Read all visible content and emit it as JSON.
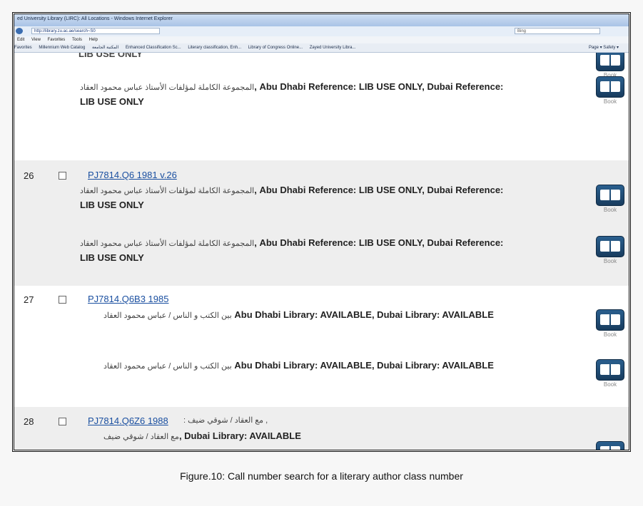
{
  "browser": {
    "title": "ed University Library (LIRC): All Locations - Windows Internet Explorer",
    "url": "http://library.zu.ac.ae/search~S0",
    "search_box": "Bing",
    "menu": [
      "Edit",
      "View",
      "Favorites",
      "Tools",
      "Help"
    ],
    "favorites": [
      "Favorites",
      "Millennium Web Catalog",
      "المكتبة الجامعة",
      "Enhanced Classification Sc...",
      "Literary classification, Enh...",
      "Library of Congress Online...",
      "Zayed University Libra..."
    ],
    "toolbar_right": "Page ▾  Safety ▾"
  },
  "top_clip": "LIB USE ONLY",
  "book_label": "Book",
  "results": [
    {
      "number": "",
      "call_number": "",
      "holdings": [
        {
          "arabic": "المجموعة الكاملة لمؤلفات الأستاذ عباس محمود العقاد",
          "latin": ", Abu Dhabi Reference: LIB USE ONLY, Dubai Reference:",
          "wrap": "LIB USE ONLY"
        }
      ]
    },
    {
      "number": "26",
      "call_number": "PJ7814.Q6 1981 v.26",
      "holdings": [
        {
          "arabic": "المجموعة الكاملة لمؤلفات الأستاذ عباس محمود العقاد",
          "latin": ", Abu Dhabi Reference: LIB USE ONLY, Dubai Reference:",
          "wrap": "LIB USE ONLY"
        },
        {
          "arabic": "المجموعة الكاملة لمؤلفات الأستاذ عباس محمود العقاد",
          "latin": ", Abu Dhabi Reference: LIB USE ONLY, Dubai Reference:",
          "wrap": "LIB USE ONLY"
        }
      ]
    },
    {
      "number": "27",
      "call_number": "PJ7814.Q6B3 1985",
      "holdings": [
        {
          "arabic": "بين الكتب و الناس / عباس محمود العقاد",
          "latin": " Abu Dhabi Library: AVAILABLE, Dubai Library: AVAILABLE",
          "wrap": ""
        },
        {
          "arabic": "بين الكتب و الناس / عباس محمود العقاد",
          "latin": " Abu Dhabi Library: AVAILABLE, Dubai Library: AVAILABLE",
          "wrap": ""
        }
      ]
    },
    {
      "number": "28",
      "call_number": "PJ7814.Q6Z6 1988",
      "title_suffix": " : مع العقاد / شوقي ضيف ,",
      "holdings": [
        {
          "arabic": "مع العقاد / شوقي ضيف",
          "latin": ", Dubai Library: AVAILABLE",
          "wrap": ""
        }
      ]
    }
  ],
  "caption": "Figure.10: Call number search for a literary author class number"
}
